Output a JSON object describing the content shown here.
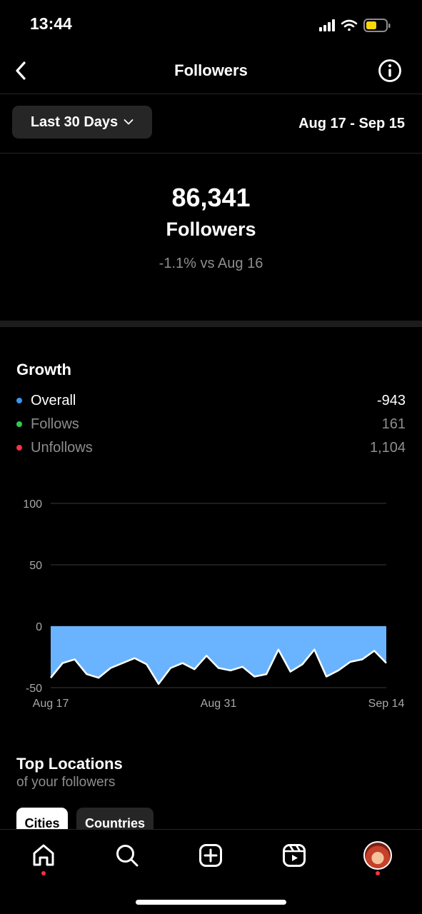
{
  "status": {
    "time": "13:44"
  },
  "nav": {
    "title": "Followers"
  },
  "filter": {
    "range_label": "Last 30 Days",
    "date_range": "Aug 17 - Sep 15"
  },
  "summary": {
    "count": "86,341",
    "label": "Followers",
    "change": "-1.1% vs Aug 16"
  },
  "growth": {
    "title": "Growth",
    "rows": [
      {
        "label": "Overall",
        "value": "-943",
        "color": "#3897f0"
      },
      {
        "label": "Follows",
        "value": "161",
        "color": "#2fcc4b"
      },
      {
        "label": "Unfollows",
        "value": "1,104",
        "color": "#ff3040"
      }
    ]
  },
  "chart_data": {
    "type": "area",
    "x_labels": [
      "Aug 17",
      "Aug 31",
      "Sep 14"
    ],
    "y_ticks": [
      100,
      50,
      0,
      -50
    ],
    "ylim": [
      -50,
      100
    ],
    "x": [
      "Aug 17",
      "Aug 18",
      "Aug 19",
      "Aug 20",
      "Aug 21",
      "Aug 22",
      "Aug 23",
      "Aug 24",
      "Aug 25",
      "Aug 26",
      "Aug 27",
      "Aug 28",
      "Aug 29",
      "Aug 30",
      "Aug 31",
      "Sep 1",
      "Sep 2",
      "Sep 3",
      "Sep 4",
      "Sep 5",
      "Sep 6",
      "Sep 7",
      "Sep 8",
      "Sep 9",
      "Sep 10",
      "Sep 11",
      "Sep 12",
      "Sep 13",
      "Sep 14"
    ],
    "values": [
      -42,
      -30,
      -27,
      -39,
      -42,
      -34,
      -30,
      -26,
      -31,
      -47,
      -34,
      -30,
      -35,
      -24,
      -34,
      -36,
      -33,
      -41,
      -39,
      -19,
      -37,
      -31,
      -19,
      -41,
      -36,
      -29,
      -27,
      -20,
      -30
    ],
    "fill_color": "#6ab4ff",
    "grid": true
  },
  "locations": {
    "title": "Top Locations",
    "subtitle": "of your followers",
    "tabs": [
      "Cities",
      "Countries"
    ]
  },
  "tabbar": {
    "items": [
      "home-icon",
      "search-icon",
      "create-icon",
      "reels-icon",
      "profile-avatar"
    ]
  }
}
